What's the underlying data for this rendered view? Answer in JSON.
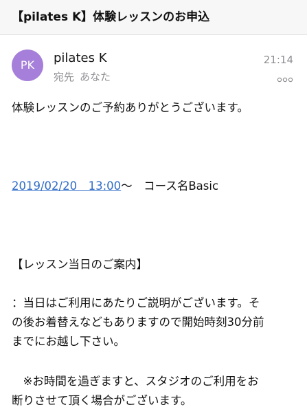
{
  "email": {
    "subject": "【pilates K】体験レッスンのお申込",
    "avatar_initials": "PK",
    "avatar_color": "#a57fd9",
    "sender_name": "pilates K",
    "time": "21:14",
    "recipient_label": "宛先",
    "recipient_name": "あなた",
    "more_icon": "ellipsis-icon"
  },
  "body": {
    "greeting": "体験レッスンのご予約ありがとうございます。",
    "datetime_link": "2019/02/20　13:00",
    "course_text": "〜　コース名Basic",
    "heading": "【レッスン当日のご案内】",
    "info_lines": [
      "：当日はご利用にあたりご説明がございます。そ",
      "の後お着替えなどもありますので開始時刻30分前",
      "までにお越し下さい。"
    ],
    "note_lines": [
      "　※お時間を過ぎますと、スタジオのご利用をお",
      "断りさせて頂く場合がございます。"
    ]
  },
  "colors": {
    "link": "#2f6cc7",
    "secondary_text": "#8e8e93",
    "header_bg": "#f7f7f7"
  }
}
